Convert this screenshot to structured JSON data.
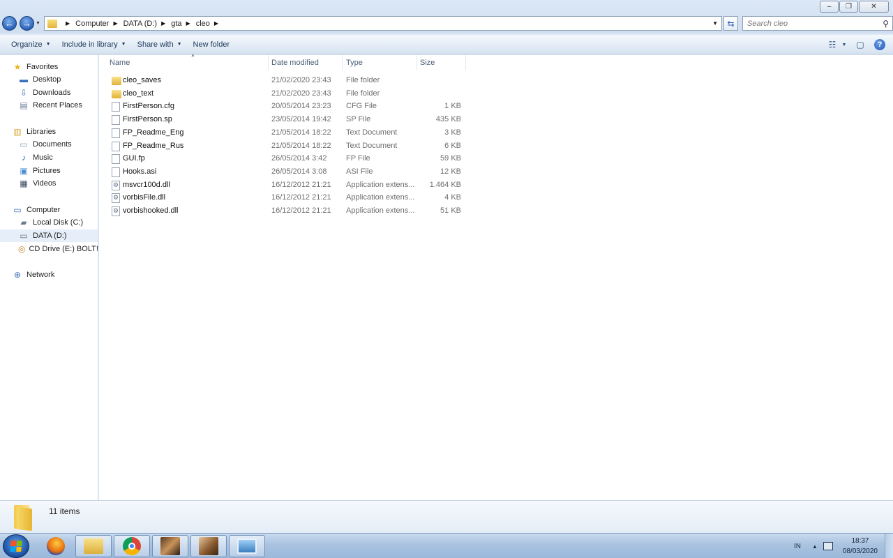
{
  "window": {
    "controls": {
      "minimize": "–",
      "maximize": "❐",
      "close": "✕"
    }
  },
  "address_bar": {
    "crumbs": [
      "Computer",
      "DATA (D:)",
      "gta",
      "cleo"
    ]
  },
  "search": {
    "placeholder": "Search cleo"
  },
  "command_bar": {
    "organize": "Organize",
    "include_in_library": "Include in library",
    "share_with": "Share with",
    "new_folder": "New folder"
  },
  "nav_pane": {
    "favorites": {
      "label": "Favorites",
      "items": [
        "Desktop",
        "Downloads",
        "Recent Places"
      ]
    },
    "libraries": {
      "label": "Libraries",
      "items": [
        "Documents",
        "Music",
        "Pictures",
        "Videos"
      ]
    },
    "computer": {
      "label": "Computer",
      "items": [
        "Local Disk (C:)",
        "DATA (D:)",
        "CD Drive (E:) BOLT! I"
      ]
    },
    "network": {
      "label": "Network"
    },
    "selected": "DATA (D:)"
  },
  "columns": {
    "name": "Name",
    "date": "Date modified",
    "type": "Type",
    "size": "Size"
  },
  "files": [
    {
      "name": "cleo_saves",
      "date": "21/02/2020 23:43",
      "type": "File folder",
      "size": "",
      "icon": "folder"
    },
    {
      "name": "cleo_text",
      "date": "21/02/2020 23:43",
      "type": "File folder",
      "size": "",
      "icon": "folder"
    },
    {
      "name": "FirstPerson.cfg",
      "date": "20/05/2014 23:23",
      "type": "CFG File",
      "size": "1 KB",
      "icon": "doc"
    },
    {
      "name": "FirstPerson.sp",
      "date": "23/05/2014 19:42",
      "type": "SP File",
      "size": "435 KB",
      "icon": "doc"
    },
    {
      "name": "FP_Readme_Eng",
      "date": "21/05/2014 18:22",
      "type": "Text Document",
      "size": "3 KB",
      "icon": "doc"
    },
    {
      "name": "FP_Readme_Rus",
      "date": "21/05/2014 18:22",
      "type": "Text Document",
      "size": "6 KB",
      "icon": "doc"
    },
    {
      "name": "GUI.fp",
      "date": "26/05/2014 3:42",
      "type": "FP File",
      "size": "59 KB",
      "icon": "doc"
    },
    {
      "name": "Hooks.asi",
      "date": "26/05/2014 3:08",
      "type": "ASI File",
      "size": "12 KB",
      "icon": "doc"
    },
    {
      "name": "msvcr100d.dll",
      "date": "16/12/2012 21:21",
      "type": "Application extens...",
      "size": "1.464 KB",
      "icon": "dll"
    },
    {
      "name": "vorbisFile.dll",
      "date": "16/12/2012 21:21",
      "type": "Application extens...",
      "size": "4 KB",
      "icon": "dll"
    },
    {
      "name": "vorbishooked.dll",
      "date": "16/12/2012 21:21",
      "type": "Application extens...",
      "size": "51 KB",
      "icon": "dll"
    }
  ],
  "details": {
    "count": "11 items"
  },
  "taskbar": {
    "apps": [
      "firefox",
      "windows-explorer",
      "chrome",
      "game-1",
      "game-2",
      "photo-viewer"
    ],
    "language": "IN",
    "time": "18:37",
    "date": "08/03/2020"
  }
}
